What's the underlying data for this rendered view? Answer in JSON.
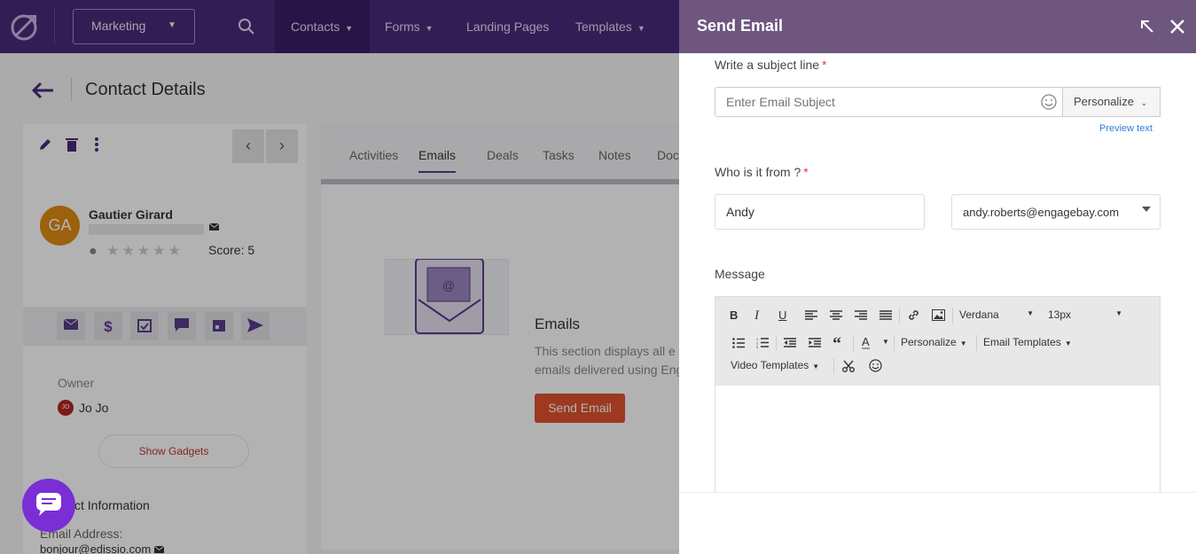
{
  "nav": {
    "workspace": "Marketing",
    "items": [
      "Contacts",
      "Forms",
      "Landing Pages",
      "Templates"
    ]
  },
  "page": {
    "title": "Contact Details"
  },
  "contact": {
    "initials": "GA",
    "name": "Gautier Girard",
    "score_label": "Score: 5",
    "owner_label": "Owner",
    "owner_initials": "JO",
    "owner_name": "Jo Jo",
    "show_gadgets": "Show Gadgets",
    "section_title": "ct Information",
    "email_label": "Email Address:",
    "email_value": "bonjour@edissio.com"
  },
  "tabs": [
    "Activities",
    "Emails",
    "Deals",
    "Tasks",
    "Notes",
    "Doc"
  ],
  "emails_section": {
    "title": "Emails",
    "desc_line1": "This section displays all e",
    "desc_line2": "emails delivered using Eng",
    "button": "Send Email"
  },
  "drawer": {
    "title": "Send Email",
    "subject_label": "Write a subject line",
    "subject_placeholder": "Enter Email Subject",
    "personalize": "Personalize",
    "preview_text": "Preview text",
    "from_label": "Who is it from ?",
    "from_name": "Andy",
    "from_email": "andy.roberts@engagebay.com",
    "message_label": "Message",
    "required_mark": "*"
  },
  "editor": {
    "font": "Verdana",
    "size": "13px",
    "personalize": "Personalize",
    "email_templates": "Email Templates",
    "video_templates": "Video Templates"
  },
  "colors": {
    "nav_bg": "#4a2a7a",
    "drawer_header": "#6e567f",
    "send_button": "#e0522e",
    "chat_bubble": "#7a2ed6",
    "link": "#2d7ed4"
  }
}
